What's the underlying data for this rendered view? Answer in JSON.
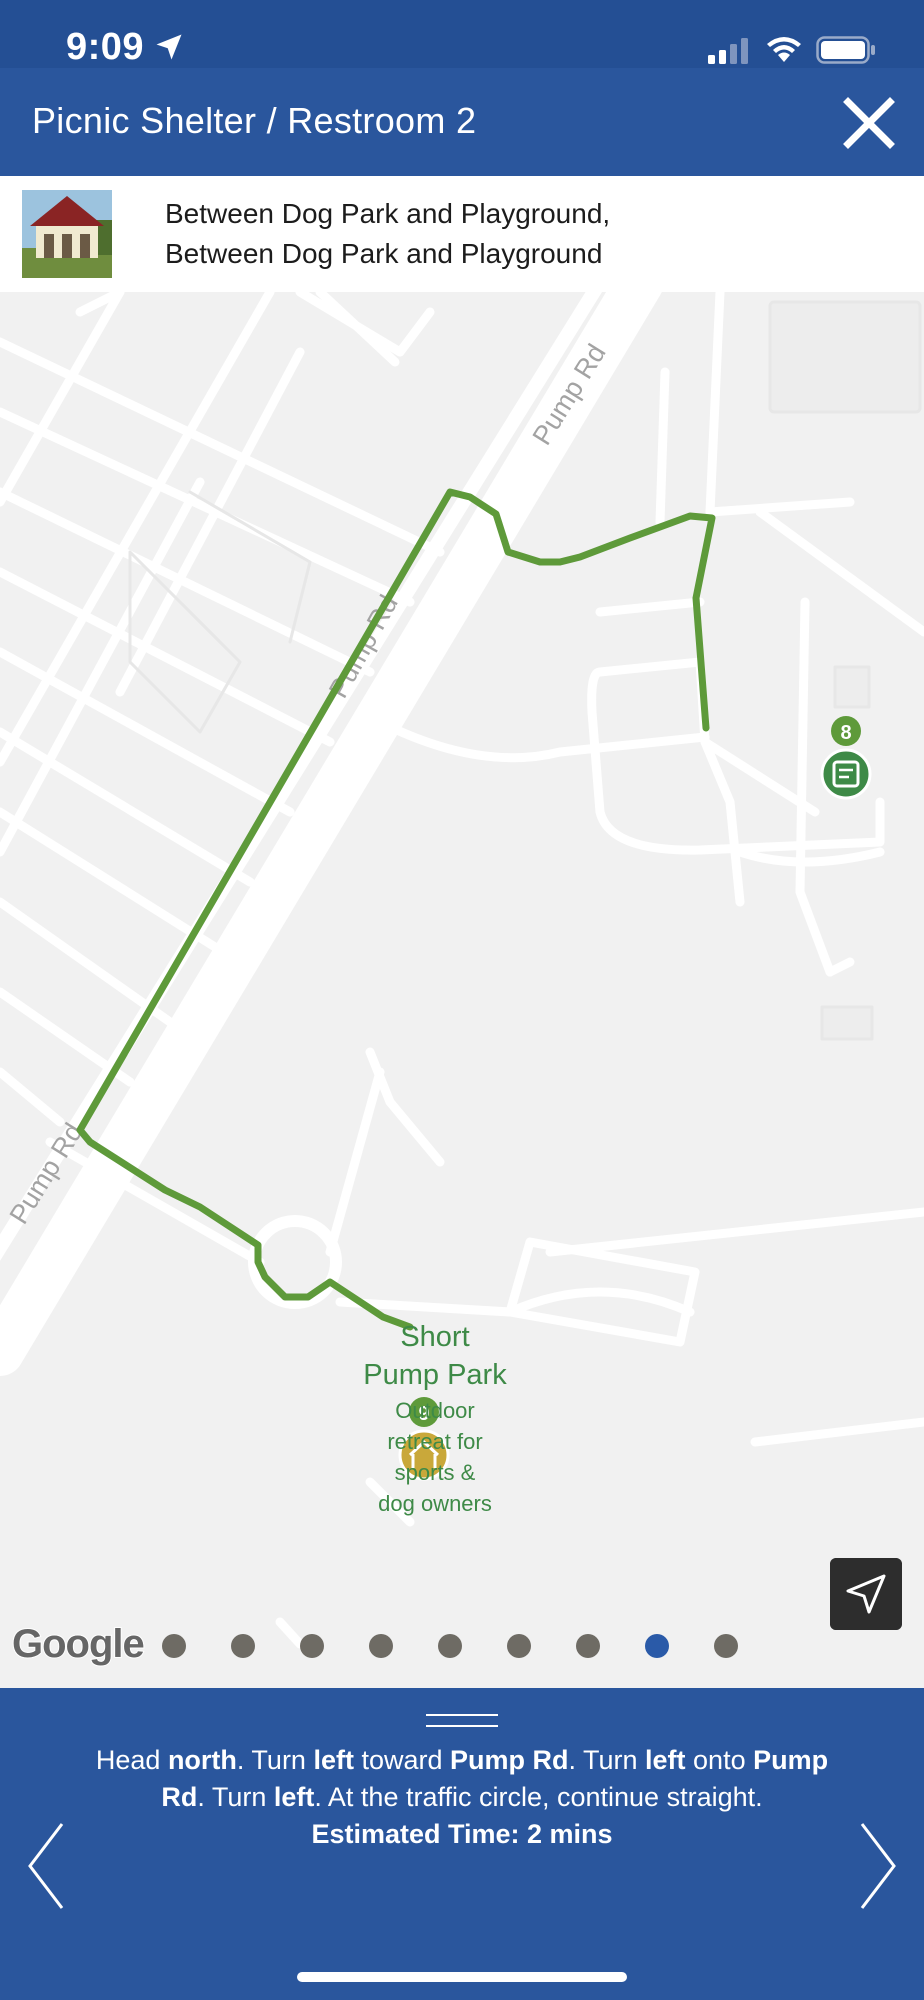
{
  "status_bar": {
    "time": "9:09"
  },
  "header": {
    "title": "Picnic Shelter / Restroom 2",
    "close_icon": "close-icon"
  },
  "info": {
    "line1": "Between Dog Park and Playground,",
    "line2": "Between Dog Park and Playground"
  },
  "map": {
    "road_labels": [
      "Pump Rd",
      "Pump Rd",
      "Pump Rd"
    ],
    "place": {
      "name_line1": "Short",
      "name_line2": "Pump Park",
      "desc_lines": [
        "Outdoor",
        "retreat for",
        "sports &",
        "dog owners"
      ]
    },
    "markers": [
      {
        "number": "8",
        "icon": "restroom-icon"
      },
      {
        "number": "9",
        "icon": "shelter-icon"
      }
    ],
    "route_color": "#5e9a3a",
    "google_logo": "Google"
  },
  "pagination": {
    "count": 9,
    "active_index": 7
  },
  "directions": {
    "segments": [
      {
        "t": "Head ",
        "b": false
      },
      {
        "t": "north",
        "b": true
      },
      {
        "t": ". Turn ",
        "b": false
      },
      {
        "t": "left",
        "b": true
      },
      {
        "t": " toward ",
        "b": false
      },
      {
        "t": "Pump Rd",
        "b": true
      },
      {
        "t": ". Turn ",
        "b": false
      },
      {
        "t": "left",
        "b": true
      },
      {
        "t": " onto ",
        "b": false
      },
      {
        "t": "Pump Rd",
        "b": true
      },
      {
        "t": ". Turn ",
        "b": false
      },
      {
        "t": "left",
        "b": true
      },
      {
        "t": ". At the traffic circle, continue straight.",
        "b": false
      }
    ],
    "estimated_time": "Estimated Time: 2 mins"
  },
  "colors": {
    "header": "#2a569d",
    "status_bar": "#244f94",
    "active_dot": "#2a5aa8"
  }
}
